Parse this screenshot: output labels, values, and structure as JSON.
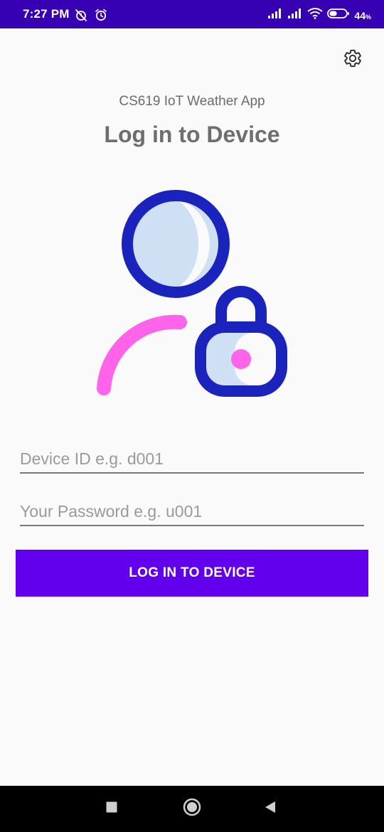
{
  "status_bar": {
    "time": "7:27 PM",
    "left_icons": [
      "alarm-off-icon",
      "alarm-icon"
    ],
    "right_icons": [
      "signal-icon",
      "signal-icon",
      "wifi-icon",
      "battery-icon"
    ],
    "battery_percent": "44",
    "battery_unit": "%",
    "battery_level": 0.44,
    "background_color": "#3700b3"
  },
  "header": {
    "settings_icon": "gear-icon",
    "app_name": "CS619 IoT Weather App",
    "title": "Log in to Device"
  },
  "illustration": {
    "icon": "user-lock-illustration",
    "colors": {
      "outline": "#1a24bd",
      "fill": "#cfe0f5",
      "accent": "#ff63ea"
    }
  },
  "form": {
    "device_id": {
      "value": "",
      "placeholder": "Device ID e.g. d001"
    },
    "password": {
      "value": "",
      "placeholder": "Your Password e.g. u001"
    },
    "submit_label": "LOG IN TO DEVICE",
    "button_color": "#6200ee"
  },
  "nav_bar": {
    "buttons": [
      "recents-icon",
      "home-icon",
      "back-icon"
    ]
  }
}
